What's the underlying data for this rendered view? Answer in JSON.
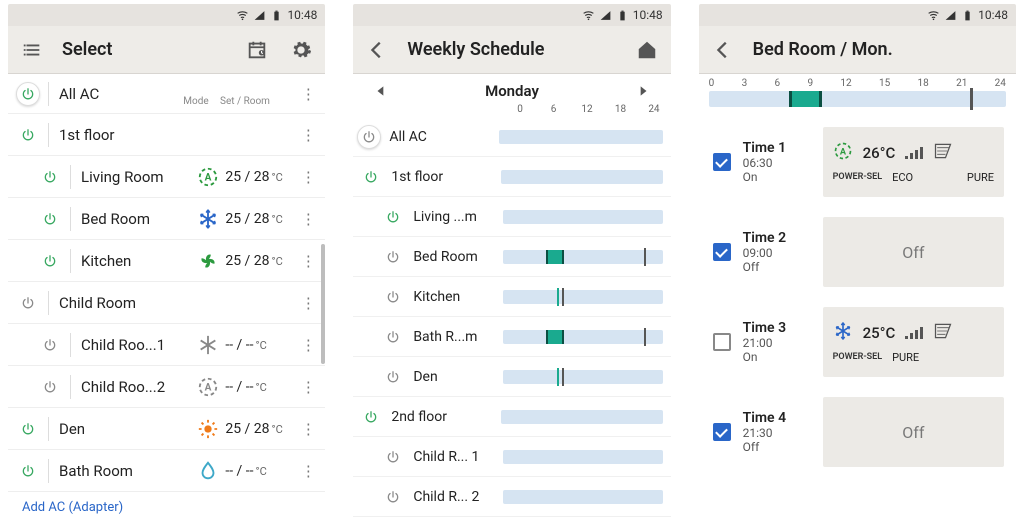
{
  "status": {
    "time": "10:48"
  },
  "select": {
    "title": "Select",
    "mode_label": "Mode",
    "setroom_label": "Set / Room",
    "rows": {
      "allac": {
        "name": "All AC",
        "on": true
      },
      "floor1": {
        "name": "1st floor",
        "on": true
      },
      "living": {
        "name": "Living Room",
        "temp": "25 / 28",
        "unit": "°C",
        "on": true
      },
      "bed": {
        "name": "Bed Room",
        "temp": "25 / 28",
        "unit": "°C",
        "on": true
      },
      "kitchen": {
        "name": "Kitchen",
        "temp": "25 / 28",
        "unit": "°C",
        "on": true
      },
      "child": {
        "name": "Child Room",
        "on": false
      },
      "child1": {
        "name": "Child Roo...1",
        "temp": "-- / --",
        "unit": "°C",
        "on": false
      },
      "child2": {
        "name": "Child Roo...2",
        "temp": "-- / --",
        "unit": "°C",
        "on": false
      },
      "den": {
        "name": "Den",
        "temp": "25 / 28",
        "unit": "°C",
        "on": true
      },
      "bath": {
        "name": "Bath Room",
        "temp": "-- / --",
        "unit": "°C",
        "on": true
      }
    },
    "add_link": "Add AC (Adapter)"
  },
  "weekly": {
    "title": "Weekly Schedule",
    "day": "Monday",
    "hours": [
      "0",
      "6",
      "12",
      "18",
      "24"
    ],
    "rows": {
      "allac": {
        "name": "All AC",
        "on": false
      },
      "floor1": {
        "name": "1st floor",
        "on": true
      },
      "living": {
        "name": "Living ...m",
        "on": true
      },
      "bed": {
        "name": "Bed Room",
        "on": false,
        "seg": [
          27,
          38
        ],
        "tick": 88
      },
      "kitchen": {
        "name": "Kitchen",
        "on": false,
        "tick": 34,
        "tick2": 37
      },
      "bathr": {
        "name": "Bath R...m",
        "on": false,
        "seg": [
          27,
          38
        ],
        "tick": 88
      },
      "den": {
        "name": "Den",
        "on": false,
        "tick": 34,
        "tick2": 37
      },
      "floor2": {
        "name": "2nd floor",
        "on": true
      },
      "childr1": {
        "name": "Child R... 1",
        "on": false
      },
      "childr2": {
        "name": "Child R... 2",
        "on": false
      }
    }
  },
  "detail": {
    "title": "Bed Room / Mon.",
    "hours": [
      "0",
      "3",
      "6",
      "9",
      "12",
      "15",
      "18",
      "21",
      "24"
    ],
    "timeline": {
      "seg": [
        27,
        38
      ],
      "tick": 88
    },
    "entries": {
      "t1": {
        "name": "Time 1",
        "clock": "06:30",
        "state": "On",
        "checked": true,
        "off": false,
        "temp": "26°C",
        "eco": "ECO",
        "pure": "PURE",
        "powersel": "POWER-SEL",
        "mode": "auto"
      },
      "t2": {
        "name": "Time 2",
        "clock": "09:00",
        "state": "Off",
        "checked": true,
        "off": true,
        "off_label": "Off"
      },
      "t3": {
        "name": "Time 3",
        "clock": "21:00",
        "state": "On",
        "checked": false,
        "off": false,
        "temp": "25°C",
        "pure": "PURE",
        "powersel": "POWER-SEL",
        "mode": "cool"
      },
      "t4": {
        "name": "Time 4",
        "clock": "21:30",
        "state": "Off",
        "checked": true,
        "off": true,
        "off_label": "Off"
      }
    }
  }
}
